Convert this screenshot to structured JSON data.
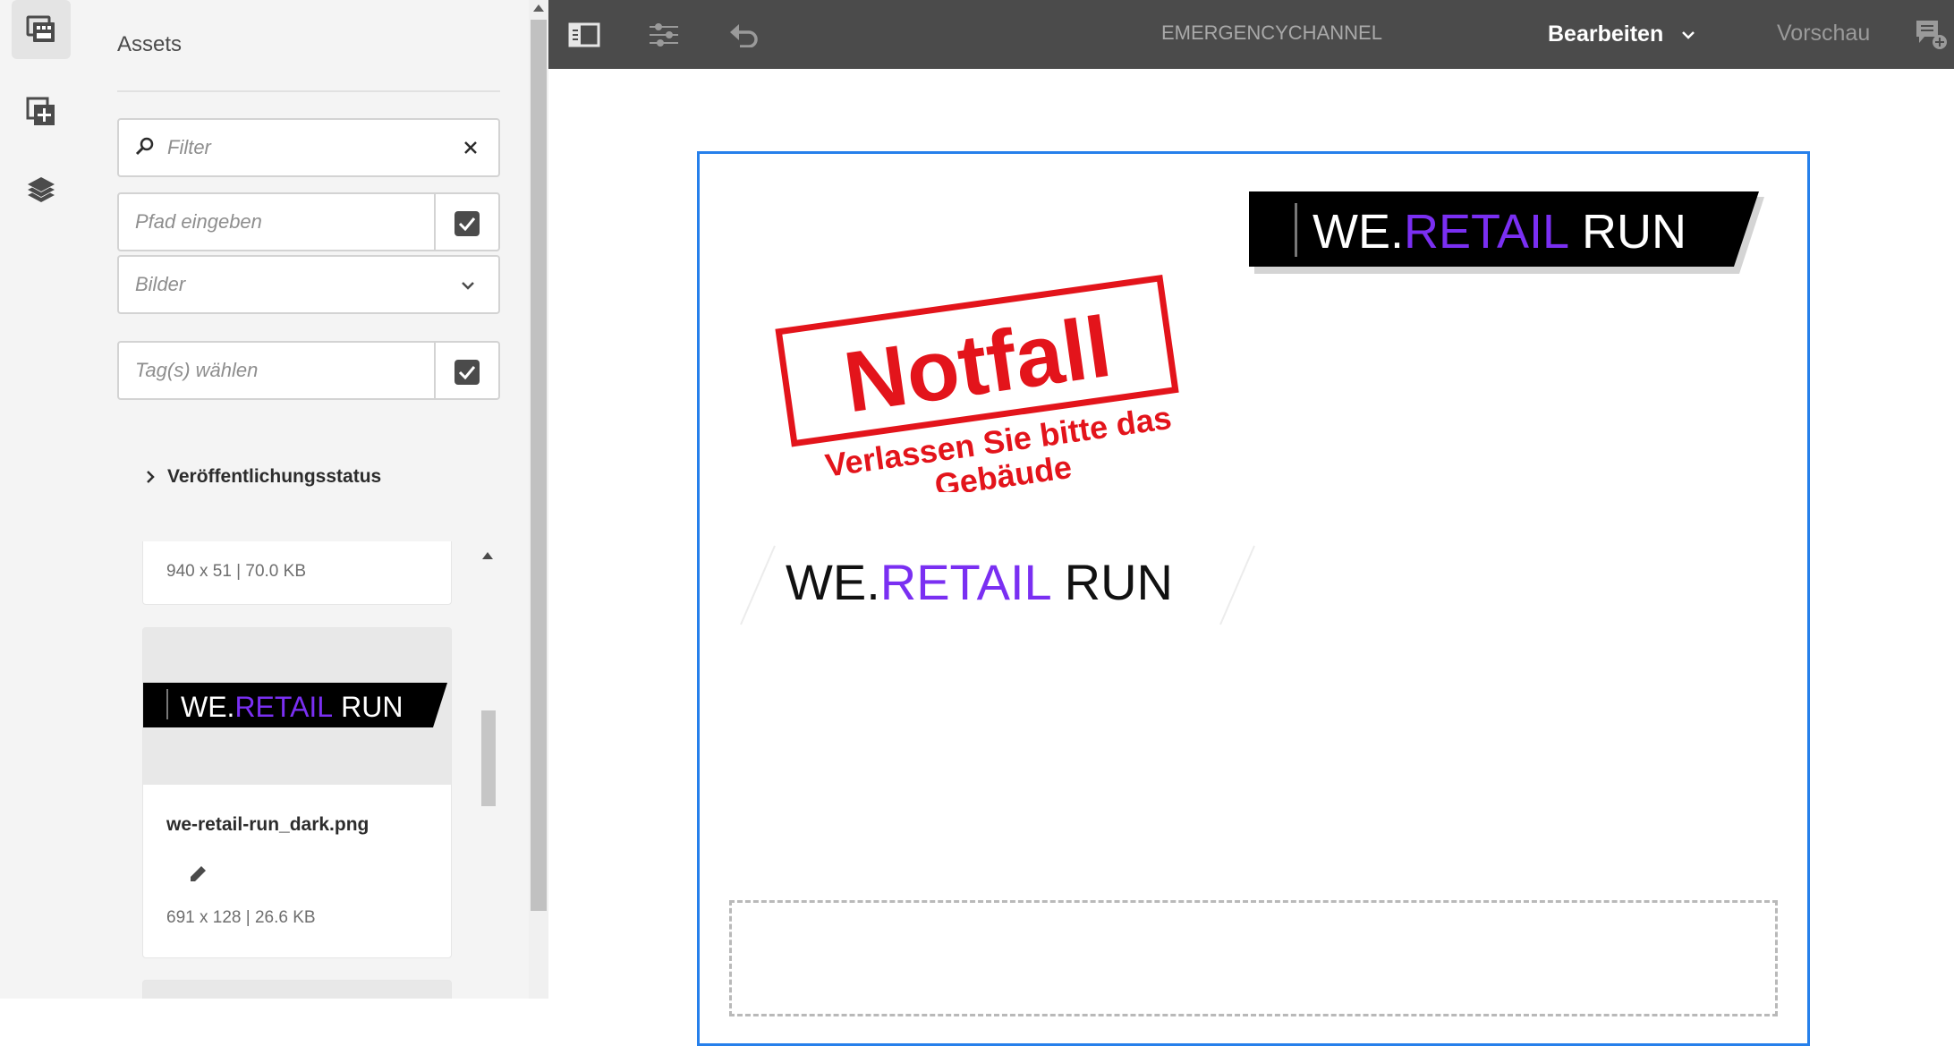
{
  "rail": {
    "items": [
      {
        "icon": "assets-icon",
        "active": true
      },
      {
        "icon": "components-add-icon",
        "active": false
      },
      {
        "icon": "layers-icon",
        "active": false
      }
    ]
  },
  "panel": {
    "title": "Assets",
    "filter_placeholder": "Filter",
    "path_placeholder": "Pfad eingeben",
    "type_select": "Bilder",
    "tags_placeholder": "Tag(s) wählen",
    "publication_status": "Veröffentlichungsstatus",
    "assets": [
      {
        "meta": "940 x 51 | 70.0 KB"
      },
      {
        "filename": "we-retail-run_dark.png",
        "meta": "691 x 128 | 26.6 KB"
      }
    ]
  },
  "toolbar": {
    "page_name": "EMERGENCYCHANNEL",
    "mode": "Bearbeiten",
    "preview": "Vorschau"
  },
  "canvas": {
    "stamp_title": "Notfall",
    "stamp_line1": "Verlassen Sie bitte das",
    "stamp_line2": "Gebäude",
    "logo_we": "WE.",
    "logo_retail": "RETAIL",
    "logo_run": "RUN"
  },
  "colors": {
    "toolbar_bg": "#4b4b4b",
    "selection_border": "#2680eb",
    "stamp_red": "#e3141b",
    "logo_purple": "#7a2ff2"
  }
}
